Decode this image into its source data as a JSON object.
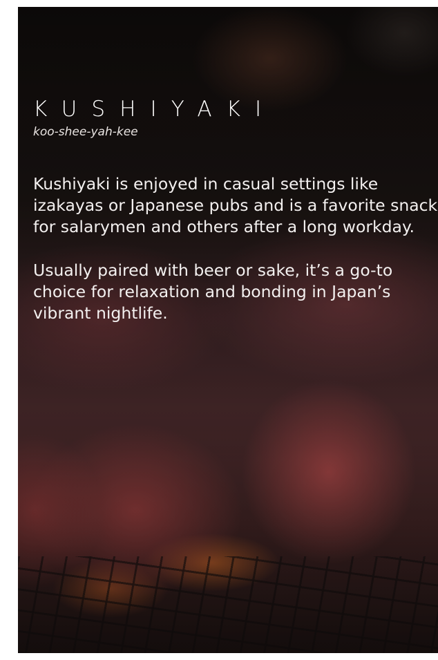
{
  "card": {
    "title": "KUSHIYAKI",
    "pronunciation": "koo-shee-yah-kee",
    "paragraphs": [
      "Kushiyaki is enjoyed in casual settings like izakayas or Japanese pubs and is a favorite snack for salarymen and others after a long workday.",
      "Usually paired with beer or sake, it’s a go-to choice for relaxation and bonding in Japan’s vibrant nightlife."
    ]
  },
  "colors": {
    "text": "#ffffff",
    "page_background": "#ffffff"
  }
}
